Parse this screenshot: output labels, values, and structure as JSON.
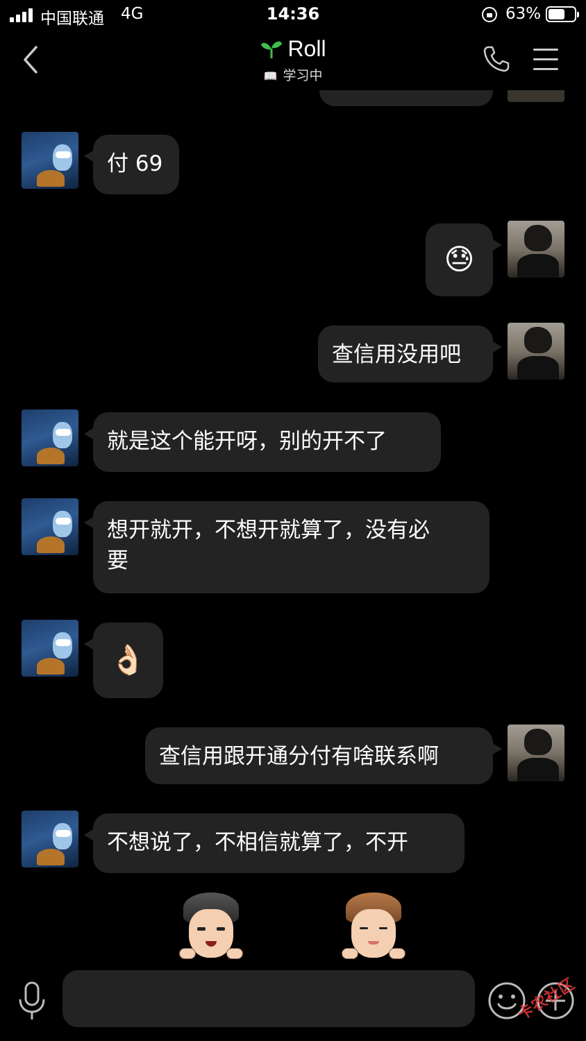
{
  "status_bar": {
    "carrier": "中国联通",
    "network": "4G",
    "time": "14:36",
    "battery": "63%",
    "battery_level": 0.63
  },
  "header": {
    "title": "Roll",
    "subtitle": "学习中",
    "icons": [
      "back-icon",
      "sprout-icon",
      "book-icon",
      "phone-icon",
      "menu-icon"
    ]
  },
  "messages": [
    {
      "side": "left",
      "text": "付 69"
    },
    {
      "side": "right",
      "text": "😓"
    },
    {
      "side": "right",
      "text": "查信用没用吧"
    },
    {
      "side": "left",
      "text": "就是这个能开呀，别的开不了"
    },
    {
      "side": "left",
      "text": "想开就开，不想开就算了，没有必\n要"
    },
    {
      "side": "left",
      "text": "👌🏻"
    },
    {
      "side": "right",
      "text": "查信用跟开通分付有啥联系啊"
    },
    {
      "side": "left",
      "text": "不想说了，不相信就算了，不开"
    }
  ],
  "input_bar": {
    "placeholder": "",
    "icons": [
      "mic-icon",
      "smile-icon",
      "plus-icon"
    ]
  },
  "watermark": "卡农社区",
  "colors": {
    "background": "#000000",
    "bubble": "#232323",
    "text": "#ffffff",
    "accent_green": "#3fbf4f"
  }
}
